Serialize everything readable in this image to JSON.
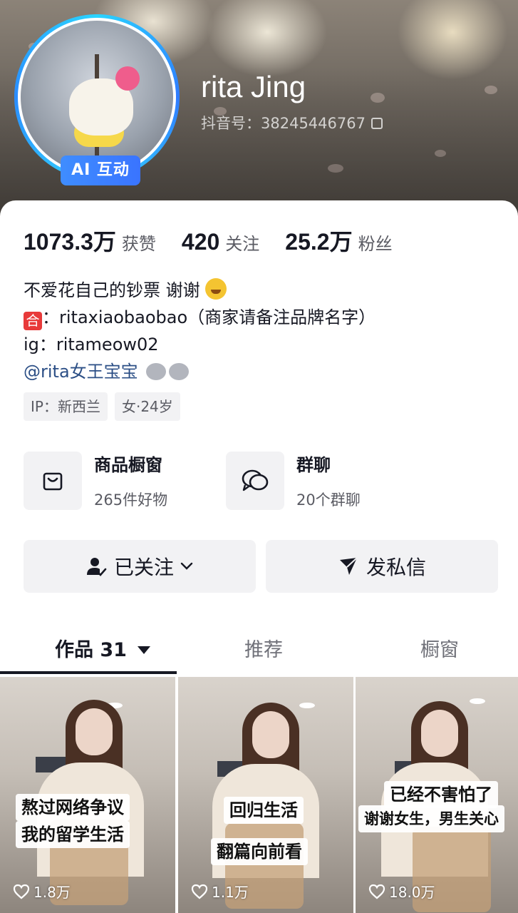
{
  "profile": {
    "name": "rita Jing",
    "douyin_id": "抖音号：38245446767",
    "ai_badge": "AI 互动"
  },
  "stats": [
    {
      "value": "1073.3万",
      "label": "获赞"
    },
    {
      "value": "420",
      "label": "关注"
    },
    {
      "value": "25.2万",
      "label": "粉丝"
    }
  ],
  "bio": {
    "line1": "不爱花自己的钞票 谢谢",
    "line2_icon": "合",
    "line2": "：ritaxiaobaobao（商家请备注品牌名字）",
    "line3": "ig：ritameow02",
    "line4": "@rita女王宝宝"
  },
  "tags": [
    "IP：新西兰",
    "女·24岁"
  ],
  "features": {
    "shop": {
      "title": "商品橱窗",
      "sub": "265件好物",
      "icon": "shopping-bag-icon"
    },
    "group": {
      "title": "群聊",
      "sub": "20个群聊",
      "icon": "chat-bubbles-icon"
    }
  },
  "actions": {
    "follow": "已关注",
    "message": "发私信"
  },
  "tabs": {
    "works": "作品 31",
    "recommend": "推荐",
    "showcase": "橱窗"
  },
  "videos": [
    {
      "caption1": "熬过网络争议",
      "caption2": "我的留学生活",
      "likes": "1.8万"
    },
    {
      "caption1": "回归生活",
      "caption2": "翻篇向前看",
      "likes": "1.1万"
    },
    {
      "caption1": "已经不害怕了",
      "caption2": "谢谢女生，男生关心",
      "likes": "18.0万"
    }
  ],
  "colors": {
    "accent_blue": "#3a74ff",
    "text_primary": "#161823",
    "text_secondary": "#5a5b63",
    "button_bg": "#f2f2f4",
    "mention": "#2c4f86"
  }
}
